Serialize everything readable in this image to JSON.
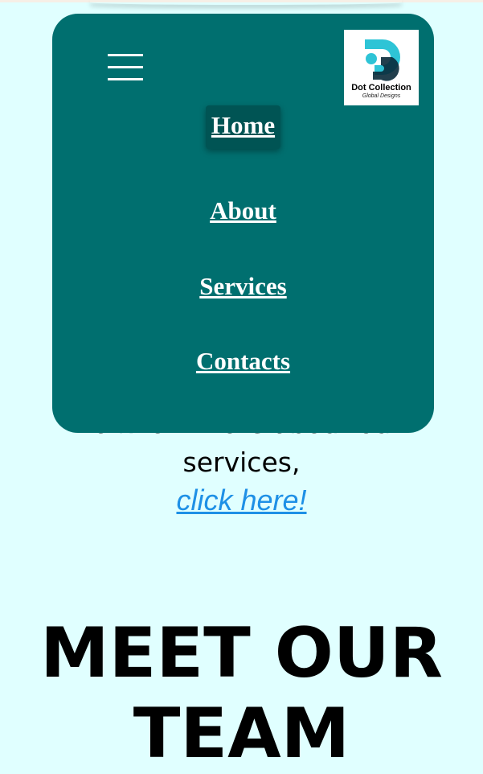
{
  "nav": {
    "items": [
      {
        "label": "Home",
        "active": true
      },
      {
        "label": "About",
        "active": false
      },
      {
        "label": "Services",
        "active": false
      },
      {
        "label": "Contacts",
        "active": false
      }
    ]
  },
  "logo": {
    "name": "Dot Collection",
    "tagline": "Global Designs",
    "colors": {
      "accent": "#2ec4d6",
      "dark": "#0a2a3a"
    }
  },
  "services_teaser": {
    "line1": "To know more about our",
    "line2": "services,",
    "link_text": "click here!"
  },
  "team": {
    "heading": "MEET OUR TEAM"
  },
  "colors": {
    "page_background": "#e0ffff",
    "nav_panel": "#006f6f",
    "nav_active_bg": "#005454",
    "link": "#1e90e6"
  }
}
